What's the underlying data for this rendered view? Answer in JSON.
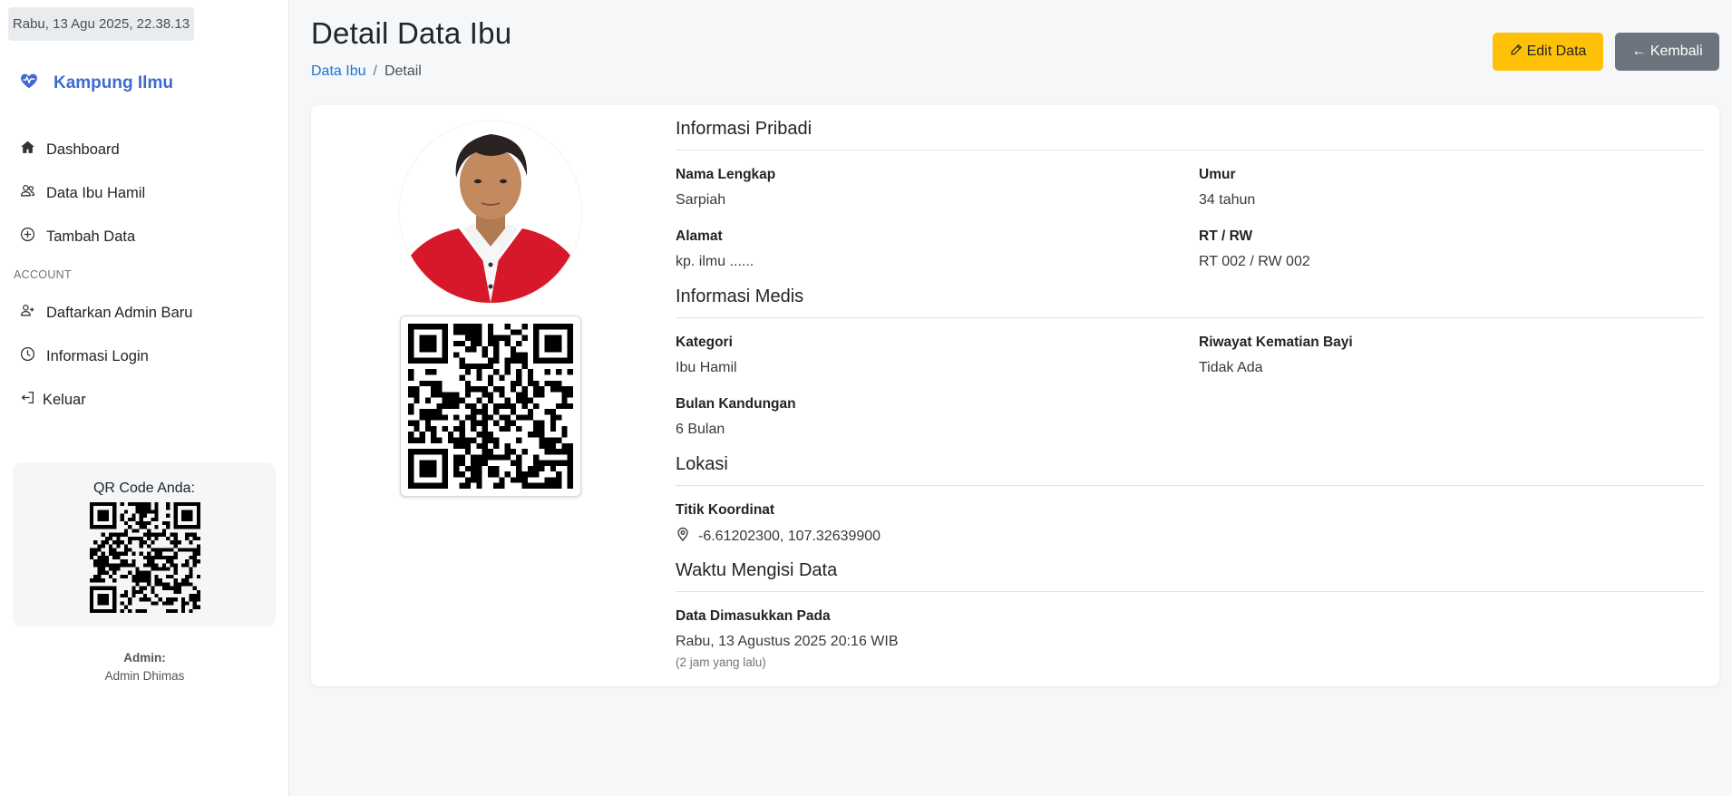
{
  "sidebar": {
    "datetime": "Rabu, 13 Agu 2025, 22.38.13",
    "brand": "Kampung Ilmu",
    "nav": [
      {
        "label": "Dashboard",
        "icon": "home-icon"
      },
      {
        "label": "Data Ibu Hamil",
        "icon": "users-icon"
      },
      {
        "label": "Tambah Data",
        "icon": "plus-circle-icon"
      }
    ],
    "section_account": "ACCOUNT",
    "account_nav": [
      {
        "label": "Daftarkan Admin Baru",
        "icon": "user-plus-icon"
      },
      {
        "label": "Informasi Login",
        "icon": "clock-icon"
      },
      {
        "label": "Keluar",
        "icon": "logout-icon"
      }
    ],
    "qr_title": "QR Code Anda:",
    "admin_label": "Admin:",
    "admin_name": "Admin Dhimas"
  },
  "header": {
    "title": "Detail Data Ibu",
    "breadcrumb": {
      "link": "Data Ibu",
      "separator": "/",
      "current": "Detail"
    },
    "edit_label": "Edit Data",
    "back_label": "← Kembali"
  },
  "detail": {
    "personal": {
      "title": "Informasi Pribadi",
      "nama_label": "Nama Lengkap",
      "nama": "Sarpiah",
      "umur_label": "Umur",
      "umur": "34 tahun",
      "alamat_label": "Alamat",
      "alamat": "kp. ilmu ......",
      "rtrw_label": "RT / RW",
      "rtrw": "RT 002 / RW 002"
    },
    "medical": {
      "title": "Informasi Medis",
      "kategori_label": "Kategori",
      "kategori": "Ibu Hamil",
      "riwayat_label": "Riwayat Kematian Bayi",
      "riwayat": "Tidak Ada",
      "bulan_label": "Bulan Kandungan",
      "bulan": "6 Bulan"
    },
    "location": {
      "title": "Lokasi",
      "koordinat_label": "Titik Koordinat",
      "koordinat": "-6.61202300, 107.32639900"
    },
    "timestamp": {
      "title": "Waktu Mengisi Data",
      "label": "Data Dimasukkan Pada",
      "value": "Rabu, 13 Agustus 2025 20:16 WIB",
      "relative": "(2 jam yang lalu)"
    }
  },
  "colors": {
    "brand": "#3d6bd0",
    "link": "#1b74d6",
    "edit": "#ffc107",
    "back": "#6c757d",
    "jacket": "#d7182a"
  }
}
